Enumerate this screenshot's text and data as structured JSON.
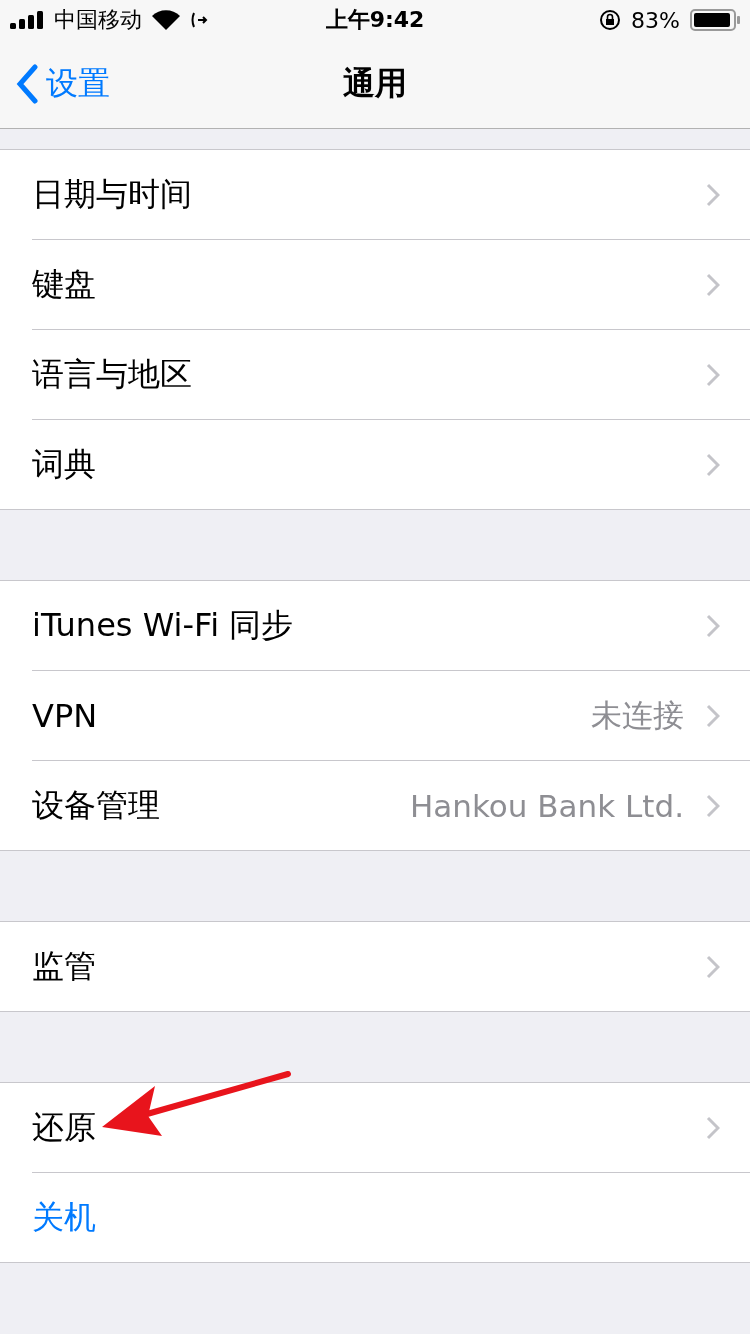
{
  "status_bar": {
    "carrier": "中国移动",
    "time": "上午9:42",
    "battery": "83%"
  },
  "nav": {
    "back": "设置",
    "title": "通用"
  },
  "groups": [
    {
      "rows": [
        {
          "kind": "link",
          "label": "日期与时间"
        },
        {
          "kind": "link",
          "label": "键盘"
        },
        {
          "kind": "link",
          "label": "语言与地区"
        },
        {
          "kind": "link",
          "label": "词典"
        }
      ]
    },
    {
      "rows": [
        {
          "kind": "link",
          "label": "iTunes Wi-Fi 同步"
        },
        {
          "kind": "link",
          "label": "VPN",
          "value": "未连接"
        },
        {
          "kind": "link",
          "label": "设备管理",
          "value": "Hankou Bank Ltd."
        }
      ]
    },
    {
      "rows": [
        {
          "kind": "link",
          "label": "监管"
        }
      ]
    },
    {
      "rows": [
        {
          "kind": "link",
          "label": "还原"
        },
        {
          "kind": "action",
          "label": "关机"
        }
      ]
    }
  ]
}
